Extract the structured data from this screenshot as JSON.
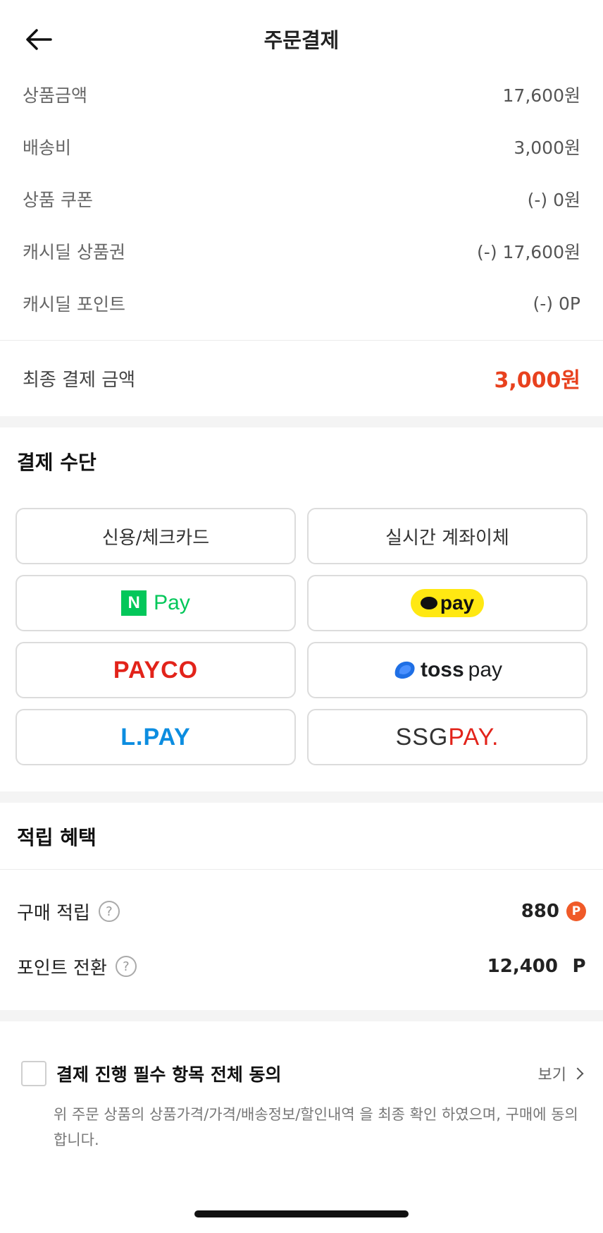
{
  "header": {
    "title": "주문결제",
    "back_icon": "arrow-left-icon"
  },
  "summary": {
    "rows": [
      {
        "label": "상품금액",
        "value": "17,600원"
      },
      {
        "label": "배송비",
        "value": "3,000원"
      },
      {
        "label": "상품 쿠폰",
        "value": "(-) 0원"
      },
      {
        "label": "캐시딜 상품권",
        "value": "(-) 17,600원"
      },
      {
        "label": "캐시딜 포인트",
        "value": "(-) 0P"
      }
    ],
    "final_label": "최종 결제 금액",
    "final_amount": "3,000원",
    "accent_color": "#e8411e"
  },
  "payment": {
    "title": "결제 수단",
    "methods": {
      "card": "신용/체크카드",
      "bank": "실시간 계좌이체",
      "naverpay": {
        "mark": "N",
        "text": "Pay"
      },
      "kakaopay": {
        "text": "pay"
      },
      "payco": "PAYCO",
      "tosspay": {
        "word1": "toss",
        "word2": "pay"
      },
      "lpay": "L.PAY",
      "ssgpay": {
        "part1": "SSG",
        "part2": "PAY."
      }
    }
  },
  "rewards": {
    "title": "적립 혜택",
    "rows": [
      {
        "label": "구매 적립",
        "value": "880",
        "help": "?",
        "badge": "P"
      },
      {
        "label": "포인트 전환",
        "value": "12,400",
        "help": "?",
        "unit": "P"
      }
    ]
  },
  "agreement": {
    "label": "결제 진행 필수 항목 전체 동의",
    "view": "보기",
    "description": "위 주문 상품의 상품가격/가격/배송정보/할인내역 을 최종 확인 하였으며, 구매에 동의 합니다."
  }
}
